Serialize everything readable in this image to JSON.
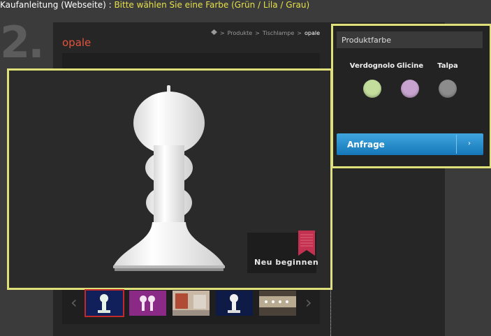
{
  "caption": {
    "prefix": "Kaufanleitung (Webseite) : ",
    "highlight": "Bitte wählen Sie eine Farbe (Grün / Lila / Grau)"
  },
  "step_number": "2.",
  "breadcrumb": {
    "items": [
      "Produkte",
      "Tischlampe"
    ],
    "current": "opale"
  },
  "product": {
    "title": "opale"
  },
  "viewer": {
    "restart_label": "Neu beginnen"
  },
  "thumbnails": {
    "count": 5,
    "selected_index": 0
  },
  "color_panel": {
    "heading": "Produktfarbe",
    "swatches": [
      {
        "name": "Verdognolo",
        "color": "#c2dd9c"
      },
      {
        "name": "Glicine",
        "color": "#c7a4cf"
      },
      {
        "name": "Talpa",
        "color": "#8c8c8c"
      }
    ],
    "request_button": "Anfrage"
  },
  "colors": {
    "highlight_frame": "#dfe07a",
    "title_red": "#e5533d",
    "button_blue": "#1f8fd0"
  }
}
